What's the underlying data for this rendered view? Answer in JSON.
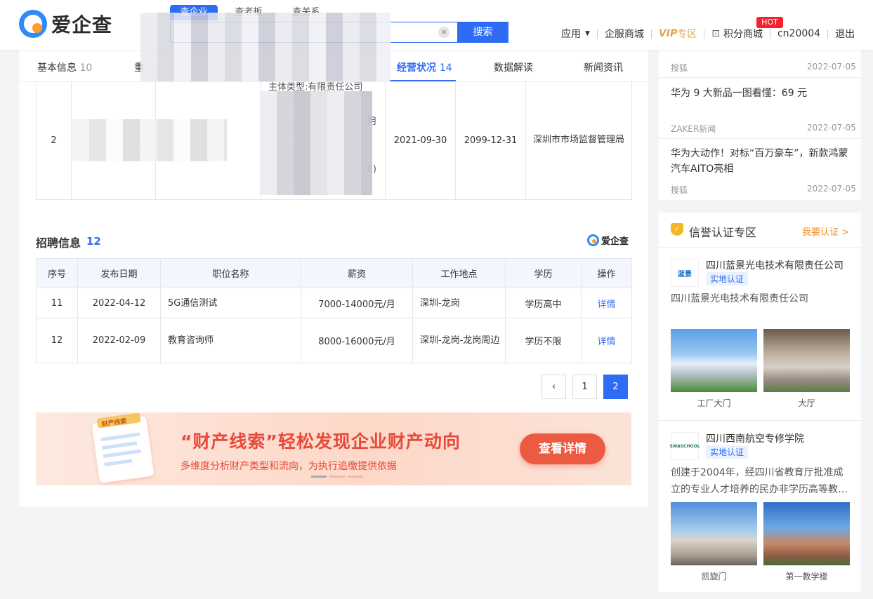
{
  "header": {
    "logo_text": "爱企查",
    "search_tabs": [
      "查企业",
      "查老板",
      "查关系"
    ],
    "search_button": "搜索",
    "clear_glyph": "×",
    "nav": {
      "apps": "应用",
      "enterprise_mall": "企服商城",
      "vip": "VIP",
      "vip_zone": "专区",
      "points_mall": "积分商城",
      "hot_badge": "HOT",
      "user": "cn20004",
      "logout": "退出"
    }
  },
  "tabs": [
    {
      "label": "基本信息",
      "count": "10"
    },
    {
      "label": "重",
      "count": ""
    },
    {
      "label": "经营状况",
      "count": "14"
    },
    {
      "label": "数据解读",
      "count": ""
    },
    {
      "label": "新闻资讯",
      "count": ""
    }
  ],
  "license_table": {
    "row": {
      "index": "2",
      "fragment_top": "主体类型:有限责任公司",
      "fragment_mid": "用",
      "fragment_bot": "0)",
      "start_date": "2021-09-30",
      "end_date": "2099-12-31",
      "authority": "深圳市市场监督管理局"
    }
  },
  "recruit": {
    "title": "招聘信息",
    "count": "12",
    "brand": "爱企查",
    "headers": [
      "序号",
      "发布日期",
      "职位名称",
      "薪资",
      "工作地点",
      "学历",
      "操作"
    ],
    "rows": [
      {
        "no": "11",
        "date": "2022-04-12",
        "position": "5G通信测试",
        "salary": "7000-14000元/月",
        "location": "深圳-龙岗",
        "edu": "学历高中",
        "action": "详情"
      },
      {
        "no": "12",
        "date": "2022-02-09",
        "position": "教育咨询师",
        "salary": "8000-16000元/月",
        "location": "深圳-龙岗-龙岗周边",
        "edu": "学历不限",
        "action": "详情"
      }
    ],
    "pagination": {
      "prev": "‹",
      "pages": [
        "1",
        "2"
      ],
      "current": "2"
    }
  },
  "banner": {
    "doc_title": "财产线索",
    "title": "“财产线索”轻松发现企业财产动向",
    "subtitle": "多维度分析财产类型和流向，为执行追缴提供依据",
    "button": "查看详情"
  },
  "news": [
    {
      "title": "",
      "source": "搜狐",
      "date": "2022-07-05"
    },
    {
      "title": "华为 9 大新品一图看懂：69 元",
      "source": "ZAKER新闻",
      "date": "2022-07-05"
    },
    {
      "title": "华为大动作！对标“百万豪车”，新款鸿蒙汽车AITO亮相",
      "source": "搜狐",
      "date": "2022-07-05"
    }
  ],
  "credit": {
    "title": "信誉认证专区",
    "link": "我要认证 >",
    "companies": [
      {
        "name": "四川蓝景光电技术有限责任公司",
        "badge": "实地认证",
        "logo_text": "蓝景",
        "desc": "四川蓝景光电技术有限责任公司",
        "photos": [
          "工厂大门",
          "大厅"
        ]
      },
      {
        "name": "四川西南航空专修学院",
        "badge": "实地认证",
        "logo_text": "SWASCHOOL",
        "desc": "创建于2004年，经四川省教育厅批准成立的专业人才培养的民办非学历高等教…",
        "photos": [
          "凯旋门",
          "第一教学楼"
        ]
      }
    ]
  },
  "colors": {
    "accent": "#2f6cf6",
    "orange": "#f0902a",
    "banner_red": "#e8493a"
  }
}
